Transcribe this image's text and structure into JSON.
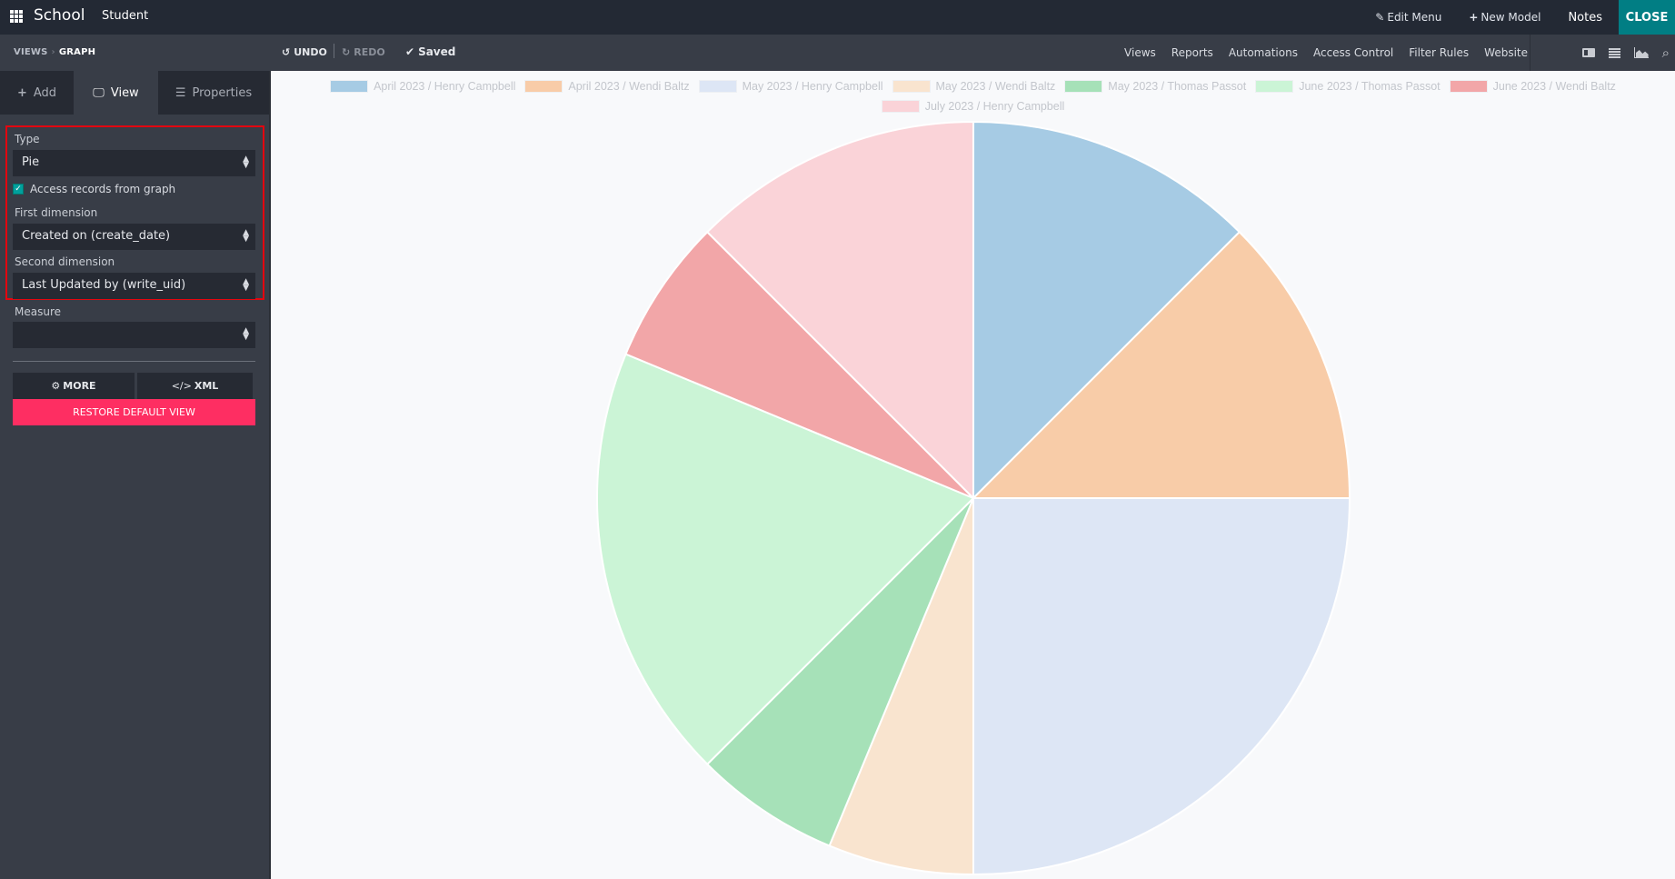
{
  "topbar": {
    "app_name": "School",
    "model_name": "Student",
    "edit_menu": "Edit Menu",
    "new_model": "New Model",
    "notes": "Notes",
    "close": "CLOSE"
  },
  "toolbar": {
    "breadcrumb": [
      "VIEWS",
      "GRAPH"
    ],
    "undo": "UNDO",
    "redo": "REDO",
    "saved": "Saved",
    "nav": [
      "Views",
      "Reports",
      "Automations",
      "Access Control",
      "Filter Rules",
      "Website"
    ],
    "view_icons": [
      "form-view-icon",
      "list-view-icon",
      "graph-view-icon",
      "search-icon"
    ]
  },
  "sidebar": {
    "tabs": [
      {
        "label": "Add",
        "icon": "plus-icon"
      },
      {
        "label": "View",
        "icon": "monitor-icon",
        "active": true
      },
      {
        "label": "Properties",
        "icon": "properties-icon"
      }
    ],
    "type_label": "Type",
    "type_value": "Pie",
    "access_records_label": "Access records from graph",
    "access_records_checked": true,
    "first_dimension_label": "First dimension",
    "first_dimension_value": "Created on (create_date)",
    "second_dimension_label": "Second dimension",
    "second_dimension_value": "Last Updated by (write_uid)",
    "measure_label": "Measure",
    "measure_value": "",
    "more_button": "MORE",
    "xml_button": "XML",
    "restore_button": "RESTORE DEFAULT VIEW"
  },
  "chart_data": {
    "type": "pie",
    "title": "",
    "legend_position": "top",
    "start_angle": "top, clockwise",
    "categories": [
      "April 2023 / Henry Campbell",
      "April 2023 / Wendi Baltz",
      "May 2023 / Henry Campbell",
      "May 2023 / Wendi Baltz",
      "May 2023 / Thomas Passot",
      "June 2023 / Thomas Passot",
      "June 2023 / Wendi Baltz",
      "July 2023 / Henry Campbell"
    ],
    "values": [
      2,
      2,
      4,
      1,
      1,
      3,
      1,
      2
    ],
    "colors": [
      "#a6cbe4",
      "#f8cca8",
      "#dde6f5",
      "#f9e4cf",
      "#a6e1b8",
      "#cbf4d6",
      "#f2a6a8",
      "#fad3d8"
    ]
  }
}
